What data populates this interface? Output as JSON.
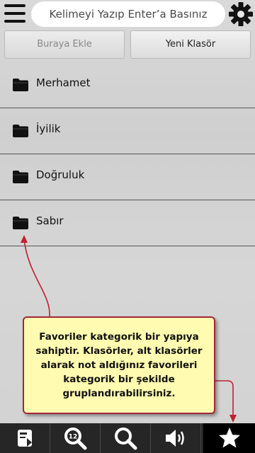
{
  "header": {
    "search_placeholder": "Kelimeyi Yazıp Enter’a Basınız",
    "menu_icon": "hamburger-menu-icon",
    "settings_icon": "gear-icon"
  },
  "actions": {
    "add_here_label": "Buraya Ekle",
    "new_folder_label": "Yeni Klasör"
  },
  "folders": [
    {
      "label": "Merhamet",
      "icon": "folder-icon"
    },
    {
      "label": "İyilik",
      "icon": "folder-icon"
    },
    {
      "label": "Doğruluk",
      "icon": "folder-icon"
    },
    {
      "label": "Sabır",
      "icon": "folder-icon"
    }
  ],
  "tooltip": {
    "text": "Favoriler kategorik bir yapıya sahiptir. Klasörler, alt klasörler alarak not aldığınız favorileri kategorik bir şekilde gruplandırabilirsiniz."
  },
  "bottom_nav": {
    "items": [
      {
        "icon": "notebook-icon"
      },
      {
        "icon": "zoom-level-icon",
        "badge": "12"
      },
      {
        "icon": "search-icon"
      },
      {
        "icon": "speaker-icon"
      },
      {
        "icon": "star-icon",
        "active": true
      }
    ]
  },
  "colors": {
    "tooltip_bg": "#fffbb0",
    "tooltip_border": "#a0283a",
    "arrow": "#c02030",
    "bottom_bar": "#262626"
  }
}
